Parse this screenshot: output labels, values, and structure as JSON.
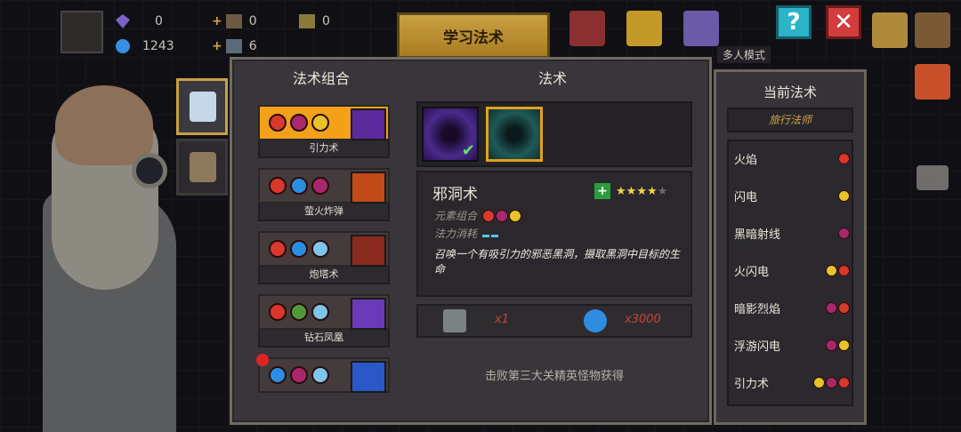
{
  "hud": {
    "gems": "0",
    "coins": "1243",
    "item_a": "0",
    "item_b": "6",
    "item_c": "0"
  },
  "top": {
    "learn_tab": "学习法术",
    "help_glyph": "?",
    "close_glyph": "✕",
    "multiplayer_label": "多人模式"
  },
  "panel": {
    "combos_title": "法术组合",
    "spells_title": "法术"
  },
  "combos": [
    {
      "label": "引力术",
      "elements": [
        "fire",
        "dark",
        "light"
      ],
      "active": true,
      "art_color": "#5b2a9c"
    },
    {
      "label": "萤火炸弹",
      "elements": [
        "fire",
        "water",
        "dark"
      ],
      "active": false,
      "art_color": "#c24a18"
    },
    {
      "label": "炮塔术",
      "elements": [
        "fire",
        "water",
        "ice"
      ],
      "active": false,
      "art_color": "#8a2a1e"
    },
    {
      "label": "钻石凤凰",
      "elements": [
        "fire",
        "earth",
        "ice"
      ],
      "active": false,
      "art_color": "#6a3ab8"
    },
    {
      "label": "",
      "elements": [
        "water",
        "dark",
        "ice"
      ],
      "active": false,
      "art_color": "#2a58c8",
      "new_badge": true
    }
  ],
  "spells": [
    {
      "name": "黑洞",
      "color": "#4a2a8c",
      "learned": true,
      "check": "✔"
    },
    {
      "name": "邪洞术",
      "color": "#1f5a58",
      "selected": true
    }
  ],
  "detail": {
    "name": "邪洞术",
    "rating_stars": 4,
    "max_stars": 5,
    "elements_label": "元素组合",
    "mana_label": "法力消耗",
    "mana_cost": 2,
    "description": "召唤一个有吸引力的邪恶黑洞，摄取黑洞中目标的生命",
    "elements": [
      "fire",
      "dark",
      "light"
    ]
  },
  "cost": {
    "scroll_count": "x1",
    "coin_count": "x3000"
  },
  "unlock_hint": "击败第三大关精英怪物获得",
  "current": {
    "title": "当前法术",
    "class": "旅行法师",
    "items": [
      {
        "name": "火焰",
        "elements": [
          "fire"
        ]
      },
      {
        "name": "闪电",
        "elements": [
          "light"
        ]
      },
      {
        "name": "黑暗射线",
        "elements": [
          "dark"
        ]
      },
      {
        "name": "火闪电",
        "elements": [
          "light",
          "fire"
        ]
      },
      {
        "name": "暗影烈焰",
        "elements": [
          "dark",
          "fire"
        ]
      },
      {
        "name": "浮游闪电",
        "elements": [
          "dark",
          "light"
        ]
      },
      {
        "name": "引力术",
        "elements": [
          "light",
          "dark",
          "fire"
        ]
      }
    ]
  },
  "colors": {
    "accent_gold": "#caa042",
    "active_orange": "#f3a01a",
    "fire": "#d9382c",
    "dark": "#a9286c",
    "light": "#e7c32a",
    "water": "#2a8fe0",
    "ice": "#7fc4ec",
    "earth": "#4c9a3a"
  }
}
